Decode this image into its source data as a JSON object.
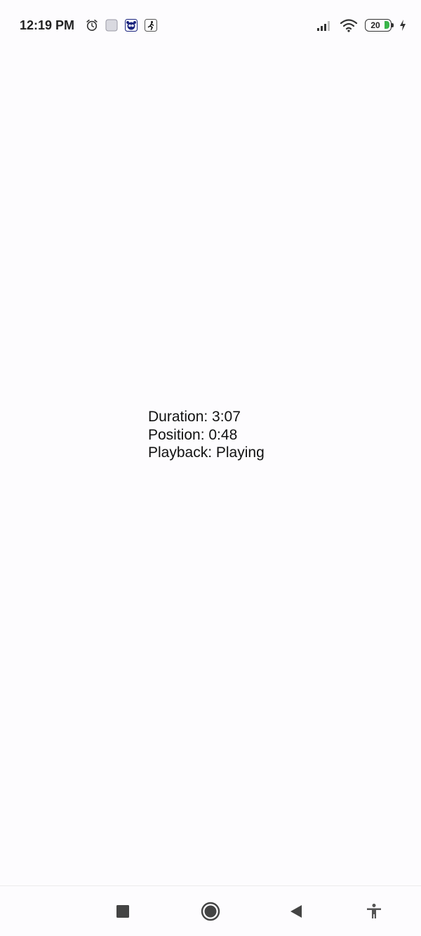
{
  "status_bar": {
    "time": "12:19 PM",
    "notification_icons": [
      "alarm-icon",
      "blank-app-icon",
      "app-icon-panda",
      "app-icon-runner"
    ],
    "battery_level": "20",
    "charging": true,
    "battery_fill_color": "#3ab54a"
  },
  "player_info": {
    "duration": "Duration: 3:07",
    "position": "Position: 0:48",
    "playback": "Playback: Playing"
  },
  "nav_bar": {
    "buttons": [
      "recents-button",
      "home-button",
      "back-button",
      "accessibility-button"
    ]
  }
}
